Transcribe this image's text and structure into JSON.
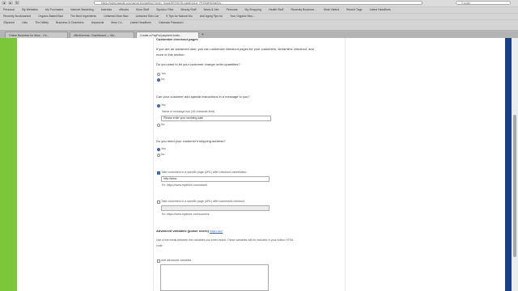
{
  "browser": {
    "url": "https://www.paypal.com/us/cgi-bin/webscr?cmd=_flow&SESSION=qdgK4cLa_PKf3rdHW|qtdVq...",
    "search_placeholder": "Google",
    "bookmarks_row1": [
      "Personal",
      "My Websites",
      "My Purchases",
      "Internet Marketing",
      "Interests",
      "eBooks",
      "Mom Stuff",
      "Squidoo Files",
      "Beauty Stuff",
      "News & Info",
      "Personal",
      "My Shopping",
      "Health Stuff",
      "Recently Bookmar...",
      "Most Visited",
      "Recent Tags",
      "Latest Headlines"
    ],
    "bookmarks_row2": [
      "Recently Bookmarked",
      "Organic Baked Bad",
      "The Best Ingredients",
      "Unfamed Mom Bad",
      "Unfamed Skin Car",
      "5 Tips for Natural Mo",
      "Anti Aging Tips for",
      "Your Organic Bea..."
    ],
    "bookmarks_row3": [
      "2Spaced",
      "Lists",
      "The Nibbly",
      "Business & Chambers",
      "Keywords",
      "Mom Co.",
      "Latest Headlines",
      "Calendar Password"
    ],
    "tabs": [
      {
        "label": "Online Business for Mom - Ho..."
      },
      {
        "label": "eBizMomma › Dashboard — Wo..."
      },
      {
        "label": "Create a PayPal payment butto..."
      }
    ],
    "new_tab": "+"
  },
  "form": {
    "section_heading": "Customize checkout pages",
    "intro_line1": "If you are an advanced user, you can customize checkout pages for your customers, streamline checkout, and",
    "intro_line2": "more in this section.",
    "q_quantity": "Do you want to let your customer change order quantities?",
    "q_quantity_yes": "Yes",
    "q_quantity_no": "No",
    "q_instructions": "Can your customer add special instructions in a message to you?",
    "q_instructions_yes": "Yes",
    "message_box_label": "Name of message box (40-character limit)",
    "message_box_value": "Please enter your wedding date",
    "q_instructions_no": "No",
    "q_shipping": "Do you need your customer's shipping address?",
    "q_shipping_yes": "Yes",
    "q_shipping_no": "No",
    "cancel_label": "Take customers to a specific page (URL) after checkout cancellation",
    "cancel_value": "http://www.",
    "cancel_example": "Ex: https://www.mystore.com/cancel",
    "success_label": "Take customers to a specific page (URL) after successful checkout",
    "success_value": "",
    "success_example": "Ex: https://www.mystore.com/success",
    "advanced_heading": "Advanced variables (power users)",
    "advanced_link": "What's this?",
    "advanced_desc_line1": "Use a line break between the variables you enter below. These variables will be included in your button HTML",
    "advanced_desc_line2": "code.",
    "add_advanced_label": "Add advanced variables"
  },
  "colors": {
    "left_bar": "#7bc639",
    "right_bar": "#1a3f88",
    "radio_selected": "#4a78c8"
  }
}
